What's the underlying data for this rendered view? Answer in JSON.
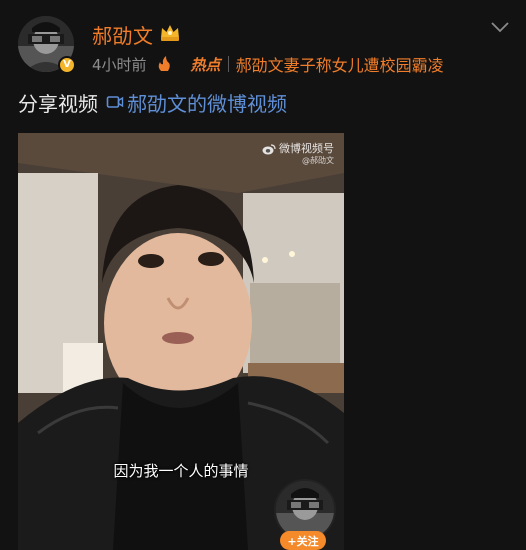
{
  "user": {
    "name": "郝劭文",
    "verified_icon": "verified-v-icon",
    "badge_icon": "crown-icon"
  },
  "meta": {
    "time": "4小时前",
    "hot_label": "热点",
    "topic": "郝劭文妻子称女儿遭校园霸凌"
  },
  "post": {
    "text": "分享视频",
    "video_link": "郝劭文的微博视频"
  },
  "video": {
    "watermark_title": "微博视频号",
    "watermark_handle": "@郝劭文",
    "subtitle": "因为我一个人的事情",
    "follow_label": "+关注"
  },
  "colors": {
    "accent": "#f07d2a",
    "link": "#5f8fd6",
    "background": "#121212"
  }
}
